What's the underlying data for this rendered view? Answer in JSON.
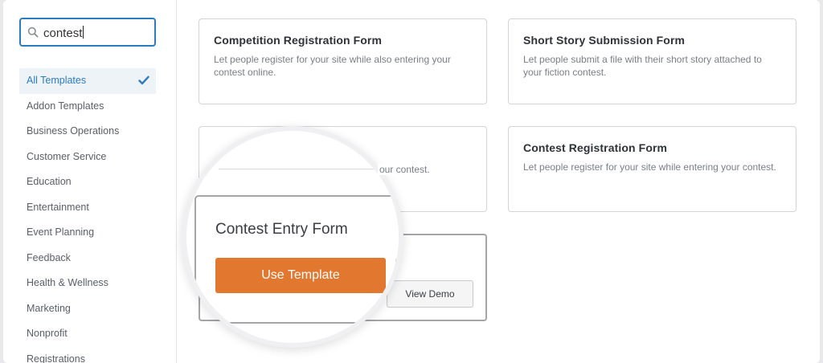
{
  "search": {
    "value": "contest"
  },
  "categories": [
    {
      "label": "All Templates",
      "active": true
    },
    {
      "label": "Addon Templates"
    },
    {
      "label": "Business Operations"
    },
    {
      "label": "Customer Service"
    },
    {
      "label": "Education"
    },
    {
      "label": "Entertainment"
    },
    {
      "label": "Event Planning"
    },
    {
      "label": "Feedback"
    },
    {
      "label": "Health & Wellness"
    },
    {
      "label": "Marketing"
    },
    {
      "label": "Nonprofit"
    },
    {
      "label": "Registrations"
    }
  ],
  "templates": [
    {
      "title": "Competition Registration Form",
      "description": "Let people register for your site while also entering your contest online."
    },
    {
      "title": "Short Story Submission Form",
      "description": "Let people submit a file with their short story attached to your fiction contest."
    },
    {
      "title_fragment": "E",
      "description_fragment": "our contest."
    },
    {
      "title": "Contest Registration Form",
      "description": "Let people register for your site while entering your contest."
    }
  ],
  "focused_template": {
    "title": "Contest Entry Form",
    "use_label": "Use Template",
    "demo_label": "View Demo"
  },
  "colors": {
    "accent": "#2b7bbf",
    "primary_button": "#e27730"
  }
}
